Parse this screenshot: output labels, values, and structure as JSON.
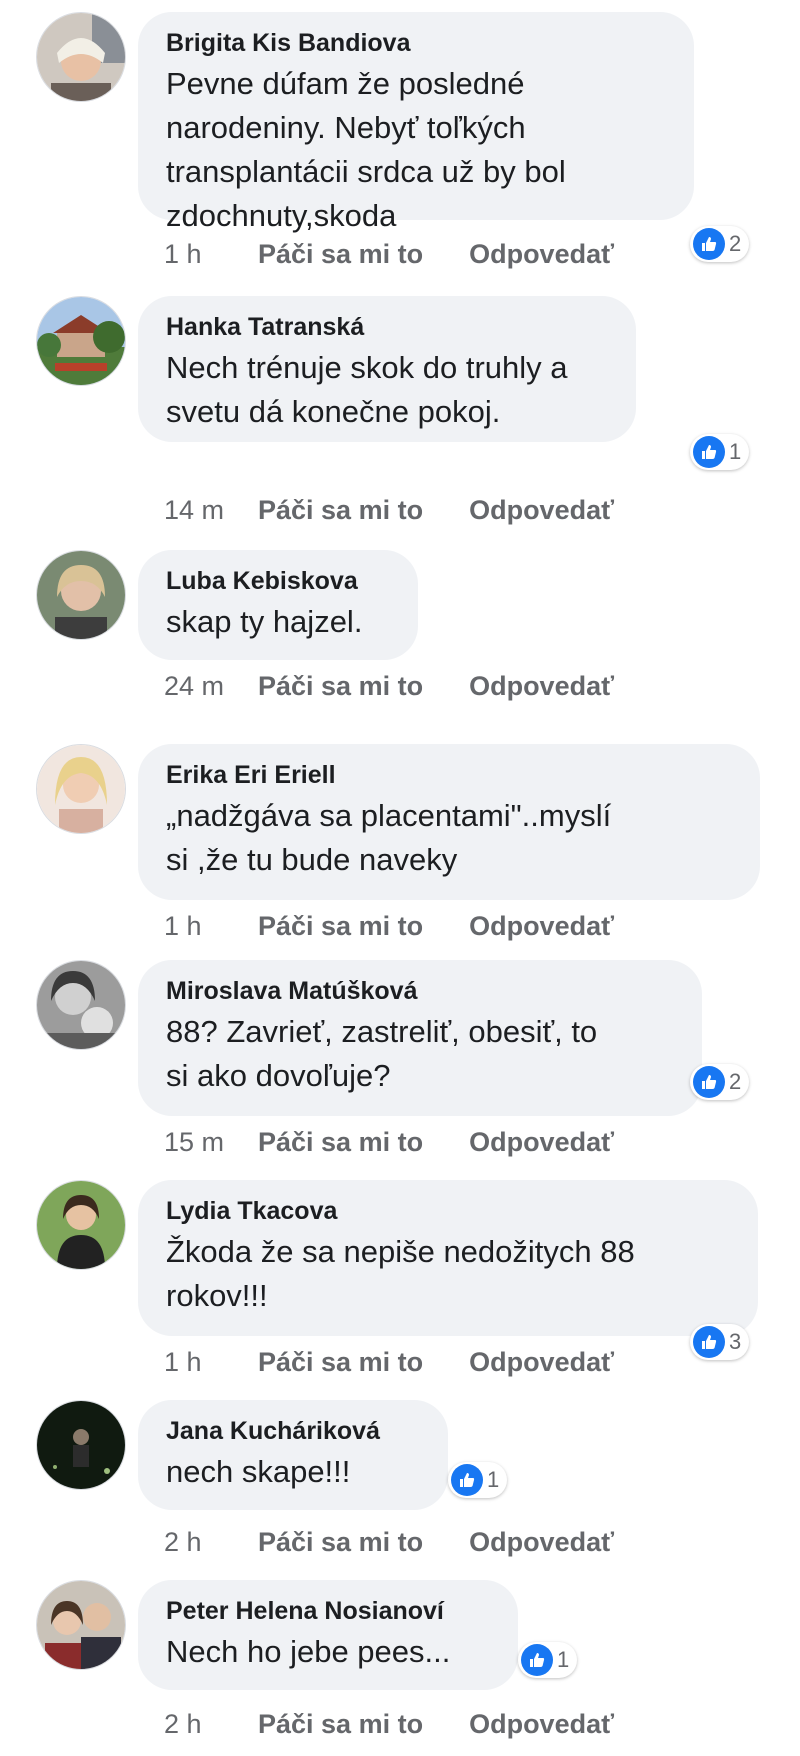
{
  "actions": {
    "like": "Páči sa mi to",
    "reply": "Odpovedať"
  },
  "comments": [
    {
      "author": "Brigita Kis Bandiova",
      "text": "Pevne dúfam že posledné\nnarodeniny. Nebyť toľkých\ntransplantácii srdca už by bol\nzdochnuty,skoda",
      "time": "1 h",
      "likes": "2"
    },
    {
      "author": "Hanka Tatranská",
      "text": "Nech trénuje skok do truhly a\nsvetu dá konečne pokoj.",
      "time": "14 m",
      "likes": "1"
    },
    {
      "author": "Luba Kebiskova",
      "text": "skap ty hajzel.",
      "time": "24 m",
      "likes": ""
    },
    {
      "author": "Erika Eri Eriell",
      "text": "„nadžgáva sa placentami\"..myslí\nsi ,že tu bude naveky",
      "time": "1 h",
      "likes": ""
    },
    {
      "author": "Miroslava Matúšková",
      "text": "88? Zavrieť, zastreliť, obesiť, to\nsi ako dovoľuje?",
      "time": "15 m",
      "likes": "2"
    },
    {
      "author": "Lydia Tkacova",
      "text": "Žkoda že sa nepiše nedožitych 88\nrokov!!!",
      "time": "1 h",
      "likes": "3"
    },
    {
      "author": "Jana Kucháriková",
      "text": "nech skape!!!",
      "time": "2 h",
      "likes": "1"
    },
    {
      "author": "Peter Helena Nosianoví",
      "text": "Nech ho jebe pees...",
      "time": "2 h",
      "likes": "1"
    }
  ],
  "colors": {
    "bubble": "#f0f2f5",
    "like_blue": "#1877f2",
    "meta": "#65676b"
  },
  "icons": {
    "reaction": "thumbs-up-icon",
    "avatar": "profile-photo"
  }
}
